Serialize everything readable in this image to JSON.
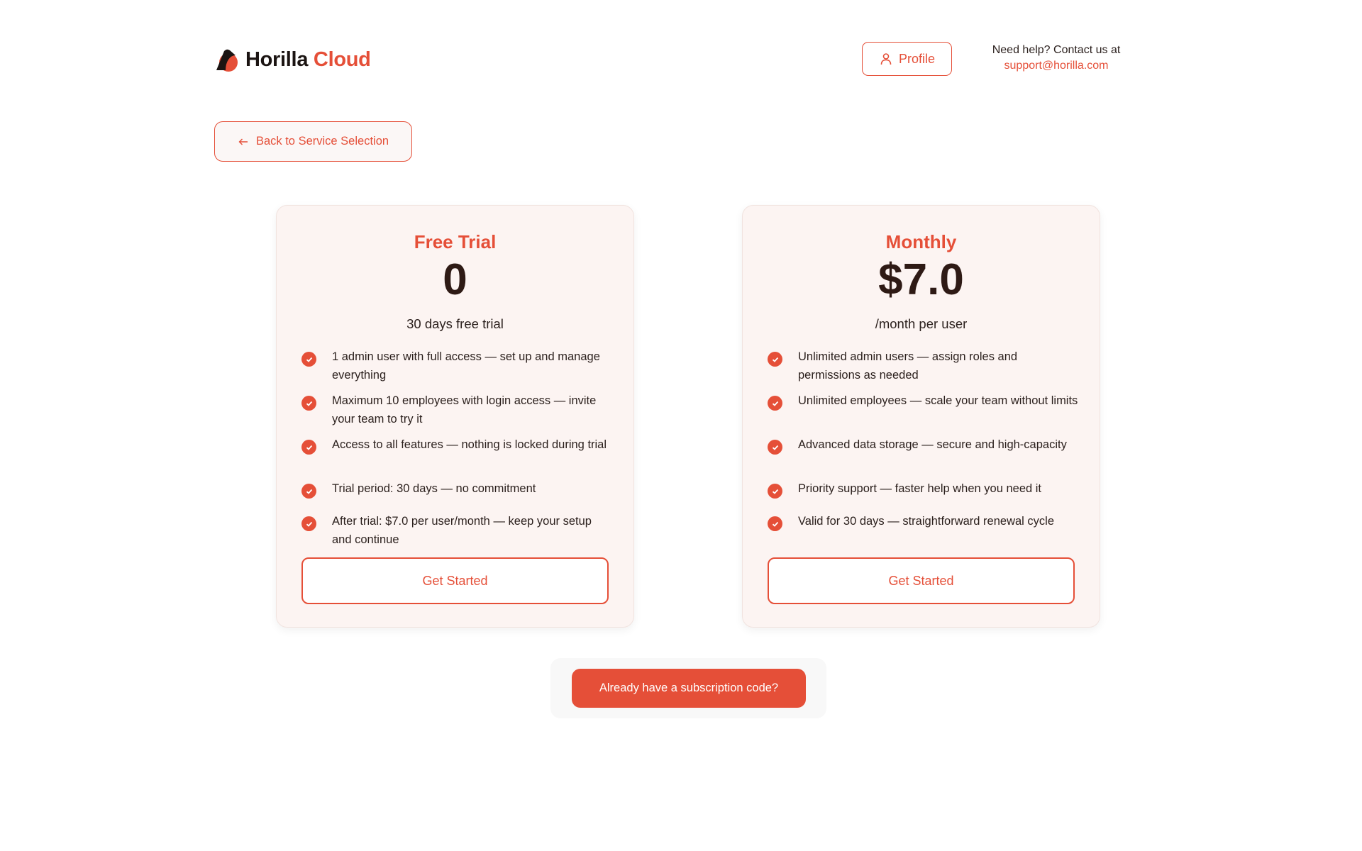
{
  "header": {
    "logo_text": "Horilla",
    "logo_accent": "Cloud",
    "profile_label": "Profile",
    "help_text": "Need help? Contact us at",
    "help_email": "support@horilla.com"
  },
  "back_button": {
    "label": "Back to Service Selection"
  },
  "plans": [
    {
      "title": "Free Trial",
      "price": "0",
      "subtitle": "30 days free trial",
      "features": [
        "1 admin user with full access — set up and manage everything",
        "Maximum 10 employees with login access — invite your team to try it",
        "Access to all features — nothing is locked during trial",
        "Trial period: 30 days — no commitment",
        "After trial: $7.0 per user/month — keep your setup and continue"
      ],
      "cta": "Get Started"
    },
    {
      "title": "Monthly",
      "price": "$7.0",
      "subtitle": "/month per user",
      "features": [
        "Unlimited admin users — assign roles and permissions as needed",
        "Unlimited employees — scale your team without limits",
        "Advanced data storage — secure and high-capacity",
        "Priority support — faster help when you need it",
        "Valid for 30 days — straightforward renewal cycle"
      ],
      "cta": "Get Started"
    }
  ],
  "subscription_code_button": "Already have a subscription code?",
  "colors": {
    "accent": "#e54f38",
    "card_bg": "#fcf4f2",
    "text_dark": "#2e1a15"
  },
  "icons": {
    "logo": "horilla-logo-icon",
    "profile": "user-icon",
    "back": "arrow-left-icon",
    "check": "check-circle-icon"
  }
}
